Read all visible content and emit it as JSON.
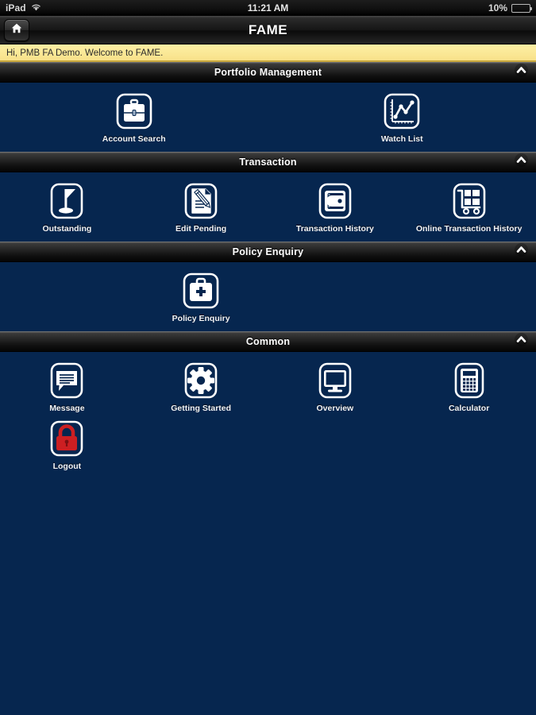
{
  "status_bar": {
    "carrier": "iPad",
    "wifi_icon": "wifi-icon",
    "time": "11:21 AM",
    "battery_percent": "10%",
    "battery_level": 10
  },
  "nav": {
    "home_icon": "home-icon",
    "title": "FAME"
  },
  "welcome": {
    "message": "Hi, PMB FA Demo. Welcome to FAME."
  },
  "sections": [
    {
      "id": "portfolio-management",
      "title": "Portfolio Management",
      "collapse_icon": "chevron-up-icon",
      "columns": 6,
      "items": [
        {
          "id": "account-search",
          "label": "Account Search",
          "icon": "briefcase-icon",
          "column": 2
        },
        {
          "id": "watch-list",
          "label": "Watch List",
          "icon": "line-chart-icon",
          "column": 5
        }
      ]
    },
    {
      "id": "transaction",
      "title": "Transaction",
      "collapse_icon": "chevron-up-icon",
      "columns": 4,
      "items": [
        {
          "id": "outstanding",
          "label": "Outstanding",
          "icon": "flag-icon"
        },
        {
          "id": "edit-pending",
          "label": "Edit Pending",
          "icon": "document-pencil-icon"
        },
        {
          "id": "transaction-history",
          "label": "Transaction History",
          "icon": "wallet-icon"
        },
        {
          "id": "online-transaction-history",
          "label": "Online Transaction History",
          "icon": "shopping-cart-icon"
        }
      ]
    },
    {
      "id": "policy-enquiry",
      "title": "Policy Enquiry",
      "collapse_icon": "chevron-up-icon",
      "columns": 4,
      "items": [
        {
          "id": "policy-enquiry",
          "label": "Policy Enquiry",
          "icon": "medical-bag-icon",
          "column": 2
        }
      ]
    },
    {
      "id": "common",
      "title": "Common",
      "collapse_icon": "chevron-up-icon",
      "columns": 4,
      "items": [
        {
          "id": "message",
          "label": "Message",
          "icon": "speech-bubble-icon"
        },
        {
          "id": "getting-started",
          "label": "Getting Started",
          "icon": "gear-icon"
        },
        {
          "id": "overview",
          "label": "Overview",
          "icon": "monitor-icon"
        },
        {
          "id": "calculator",
          "label": "Calculator",
          "icon": "calculator-icon"
        },
        {
          "id": "logout",
          "label": "Logout",
          "icon": "lock-icon",
          "column": 1
        }
      ]
    }
  ],
  "colors": {
    "background_blue": "#06264f",
    "banner_yellow": "#f8e18a",
    "icon_white": "#ffffff",
    "logout_red": "#cc1f22",
    "battery_red": "#d42b1f"
  }
}
